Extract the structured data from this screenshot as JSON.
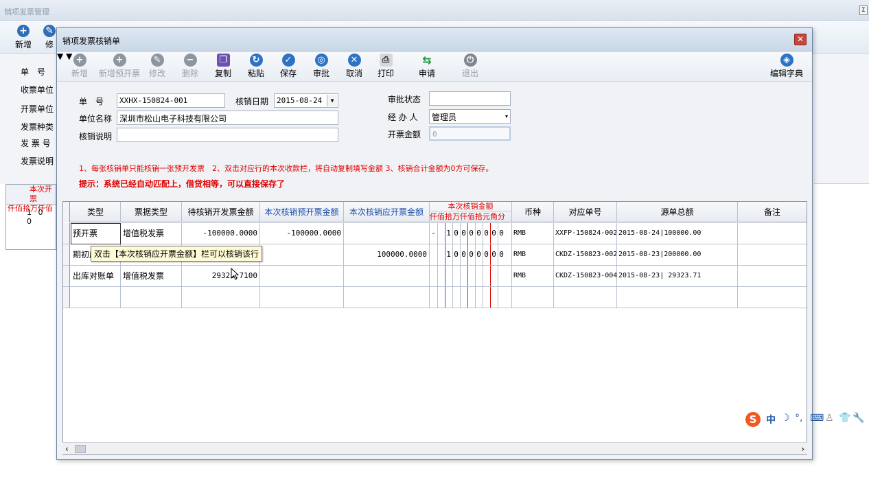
{
  "bg_window": {
    "title": "销项发票管理",
    "toolbar": [
      {
        "label": "新增"
      },
      {
        "label": "修"
      }
    ],
    "form_labels": [
      "单　号",
      "收票单位",
      "开票单位",
      "发票种类",
      "发 票 号",
      "发票说明"
    ],
    "mini_grid": {
      "header_top": "本次开票",
      "header_bottom": "仟佰拾万仟佰",
      "row_digits": "1 0 0"
    }
  },
  "dialog": {
    "title": "销项发票核销单",
    "close_glyph": "✕",
    "toolbar": [
      {
        "label": "新增",
        "icon": "plus-icon",
        "enabled": false
      },
      {
        "label": "新增预开票",
        "icon": "plus-icon",
        "enabled": false
      },
      {
        "label": "修改",
        "icon": "edit-icon",
        "enabled": false
      },
      {
        "label": "删除",
        "icon": "minus-icon",
        "enabled": false
      },
      {
        "label": "复制",
        "icon": "copy-icon",
        "enabled": true
      },
      {
        "label": "粘贴",
        "icon": "paste-icon",
        "enabled": true
      },
      {
        "label": "保存",
        "icon": "check-icon",
        "enabled": true
      },
      {
        "label": "审批",
        "icon": "approve-icon",
        "enabled": true
      },
      {
        "label": "取消",
        "icon": "cancel-icon",
        "enabled": true
      },
      {
        "label": "打印",
        "icon": "print-icon",
        "enabled": true
      },
      {
        "label": "申请",
        "icon": "arrows-icon",
        "enabled": true
      },
      {
        "label": "退出",
        "icon": "exit-icon",
        "enabled": false
      },
      {
        "label": "编辑字典",
        "icon": "dictionary-icon",
        "enabled": true
      }
    ],
    "form": {
      "doc_no_label": "单　号",
      "doc_no": "XXHX-150824-001",
      "date_label": "核销日期",
      "date": "2015-08-24",
      "company_label": "单位名称",
      "company": "深圳市松山电子科技有限公司",
      "note_label": "核销说明",
      "note": "",
      "approval_label": "审批状态",
      "approval": "",
      "handler_label": "经 办 人",
      "handler": "管理员",
      "amount_label": "开票金额",
      "amount": "0"
    },
    "tips": {
      "line1": "1、每张核销单只能核销一张预开发票　2、双击对应行的本次收款栏，将自动复制填写金额 3、核销合计金额为0方可保存。",
      "line2": "提示：系统已经自动匹配上，借贷相等，可以直接保存了"
    },
    "grid": {
      "headers": {
        "type": "类型",
        "bill_type": "票据类型",
        "pending": "待核销开发票金额",
        "pre_amount": "本次核销预开票金额",
        "due_amount": "本次核销应开票金额",
        "amount_group": "本次核销金额",
        "digits": [
          "仟",
          "佰",
          "拾",
          "万",
          "仟",
          "佰",
          "拾",
          "元",
          "角",
          "分"
        ],
        "currency": "币种",
        "ref_no": "对应单号",
        "source_total": "源单总额",
        "remark": "备注"
      },
      "rows": [
        {
          "type": "预开票",
          "bill_type": "增值税发票",
          "pending": "-100000.0000",
          "pre_amount": "-100000.0000",
          "due_amount": "",
          "sign": "-",
          "digits": [
            "",
            "1",
            "0",
            "0",
            "0",
            "0",
            "0",
            "0",
            "0",
            ""
          ],
          "currency": "RMB",
          "ref_no": "XXFP-150824-002",
          "source_total": "2015-08-24|100000.00",
          "remark": ""
        },
        {
          "type": "期初应",
          "bill_type": "",
          "pending": "",
          "pre_amount": "",
          "due_amount": "100000.0000",
          "sign": "",
          "digits": [
            "",
            "1",
            "0",
            "0",
            "0",
            "0",
            "0",
            "0",
            "0",
            ""
          ],
          "currency": "RMB",
          "ref_no": "CKDZ-150823-002",
          "source_total": "2015-08-23|200000.00",
          "remark": ""
        },
        {
          "type": "出库对账单",
          "bill_type": "增值税发票",
          "pending": "29323.7100",
          "pre_amount": "",
          "due_amount": "",
          "sign": "",
          "digits": [
            "",
            "",
            "",
            "",
            "",
            "",
            "",
            "",
            "",
            ""
          ],
          "currency": "RMB",
          "ref_no": "CKDZ-150823-004",
          "source_total": "2015-08-23| 29323.71",
          "remark": ""
        },
        {
          "type": "",
          "bill_type": "",
          "pending": "",
          "pre_amount": "",
          "due_amount": "",
          "sign": "",
          "digits": [
            "",
            "",
            "",
            "",
            "",
            "",
            "",
            "",
            "",
            ""
          ],
          "currency": "",
          "ref_no": "",
          "source_total": "",
          "remark": ""
        }
      ],
      "tooltip": "双击【本次核销应开票金额】栏可以核销该行"
    }
  },
  "ime": {
    "logo": "S",
    "mode": "中",
    "icons": [
      "moon-icon",
      "punctuation-icon",
      "keyboard-icon",
      "user-icon",
      "shirt-icon",
      "wrench-icon"
    ]
  }
}
